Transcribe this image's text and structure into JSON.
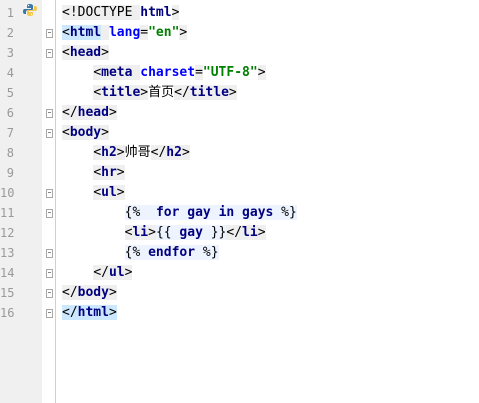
{
  "editor": {
    "line_numbers": [
      "1",
      "2",
      "3",
      "4",
      "5",
      "6",
      "7",
      "8",
      "9",
      "10",
      "11",
      "12",
      "13",
      "14",
      "15",
      "16"
    ],
    "gutter_icon": "python-icon",
    "lines": [
      [
        {
          "t": "<!DOCTYPE ",
          "c": "punct"
        },
        {
          "t": "html",
          "c": "doctype-kw"
        },
        {
          "t": ">",
          "c": "punct"
        }
      ],
      [
        {
          "t": "<",
          "c": "punct-hl"
        },
        {
          "t": "html",
          "c": "tag-hl"
        },
        {
          "t": " ",
          "c": "punct"
        },
        {
          "t": "lang",
          "c": "attr"
        },
        {
          "t": "=",
          "c": "punct"
        },
        {
          "t": "\"en\"",
          "c": "str"
        },
        {
          "t": ">",
          "c": "punct"
        }
      ],
      [
        {
          "t": "<",
          "c": "punct"
        },
        {
          "t": "head",
          "c": "tag"
        },
        {
          "t": ">",
          "c": "punct"
        }
      ],
      [
        {
          "t": "    ",
          "c": "plain"
        },
        {
          "t": "<",
          "c": "punct"
        },
        {
          "t": "meta",
          "c": "tag"
        },
        {
          "t": " ",
          "c": "punct"
        },
        {
          "t": "charset",
          "c": "attr"
        },
        {
          "t": "=",
          "c": "punct"
        },
        {
          "t": "\"UTF-8\"",
          "c": "str"
        },
        {
          "t": ">",
          "c": "punct"
        }
      ],
      [
        {
          "t": "    ",
          "c": "plain"
        },
        {
          "t": "<",
          "c": "punct"
        },
        {
          "t": "title",
          "c": "tag"
        },
        {
          "t": ">",
          "c": "punct"
        },
        {
          "t": "首页",
          "c": "plain"
        },
        {
          "t": "</",
          "c": "punct"
        },
        {
          "t": "title",
          "c": "tag"
        },
        {
          "t": ">",
          "c": "punct"
        }
      ],
      [
        {
          "t": "</",
          "c": "punct"
        },
        {
          "t": "head",
          "c": "tag"
        },
        {
          "t": ">",
          "c": "punct"
        }
      ],
      [
        {
          "t": "<",
          "c": "punct"
        },
        {
          "t": "body",
          "c": "tag"
        },
        {
          "t": ">",
          "c": "punct"
        }
      ],
      [
        {
          "t": "    ",
          "c": "plain"
        },
        {
          "t": "<",
          "c": "punct"
        },
        {
          "t": "h2",
          "c": "tag"
        },
        {
          "t": ">",
          "c": "punct"
        },
        {
          "t": "帅哥",
          "c": "plain"
        },
        {
          "t": "</",
          "c": "punct"
        },
        {
          "t": "h2",
          "c": "tag"
        },
        {
          "t": ">",
          "c": "punct"
        }
      ],
      [
        {
          "t": "    ",
          "c": "plain"
        },
        {
          "t": "<",
          "c": "punct"
        },
        {
          "t": "hr",
          "c": "tag"
        },
        {
          "t": ">",
          "c": "punct"
        }
      ],
      [
        {
          "t": "    ",
          "c": "plain"
        },
        {
          "t": "<",
          "c": "punct"
        },
        {
          "t": "ul",
          "c": "tag"
        },
        {
          "t": ">",
          "c": "punct"
        }
      ],
      [
        {
          "t": "        ",
          "c": "plain"
        },
        {
          "t": "{%  ",
          "c": "tpl"
        },
        {
          "t": "for",
          "c": "kw"
        },
        {
          "t": " ",
          "c": "tpl"
        },
        {
          "t": "gay",
          "c": "var"
        },
        {
          "t": " ",
          "c": "tpl"
        },
        {
          "t": "in",
          "c": "kw"
        },
        {
          "t": " ",
          "c": "tpl"
        },
        {
          "t": "gays",
          "c": "var"
        },
        {
          "t": " %}",
          "c": "tpl"
        }
      ],
      [
        {
          "t": "        ",
          "c": "plain"
        },
        {
          "t": "<",
          "c": "punct"
        },
        {
          "t": "li",
          "c": "tag"
        },
        {
          "t": ">",
          "c": "punct"
        },
        {
          "t": "{{ ",
          "c": "tpl"
        },
        {
          "t": "gay",
          "c": "var"
        },
        {
          "t": " }}",
          "c": "tpl"
        },
        {
          "t": "</",
          "c": "punct"
        },
        {
          "t": "li",
          "c": "tag"
        },
        {
          "t": ">",
          "c": "punct"
        }
      ],
      [
        {
          "t": "        ",
          "c": "plain"
        },
        {
          "t": "{% ",
          "c": "tpl"
        },
        {
          "t": "endfor",
          "c": "kw"
        },
        {
          "t": " %}",
          "c": "tpl"
        }
      ],
      [
        {
          "t": "    ",
          "c": "plain"
        },
        {
          "t": "</",
          "c": "punct"
        },
        {
          "t": "ul",
          "c": "tag"
        },
        {
          "t": ">",
          "c": "punct"
        }
      ],
      [
        {
          "t": "</",
          "c": "punct"
        },
        {
          "t": "body",
          "c": "tag"
        },
        {
          "t": ">",
          "c": "punct"
        }
      ],
      [
        {
          "t": "</",
          "c": "punct-hl"
        },
        {
          "t": "html",
          "c": "tag-hl"
        },
        {
          "t": ">",
          "c": "punct-hl"
        }
      ]
    ],
    "fold_markers": [
      false,
      true,
      true,
      false,
      false,
      true,
      true,
      false,
      false,
      true,
      true,
      false,
      true,
      true,
      true,
      true
    ],
    "current_line": 16,
    "colors": {
      "gutter_bg": "#f0f0f0",
      "current_line_bg": "#fffae3",
      "tag": "#000080",
      "attr": "#0000ff",
      "string": "#008000",
      "matched_tag_bg": "#cce8ff"
    }
  }
}
